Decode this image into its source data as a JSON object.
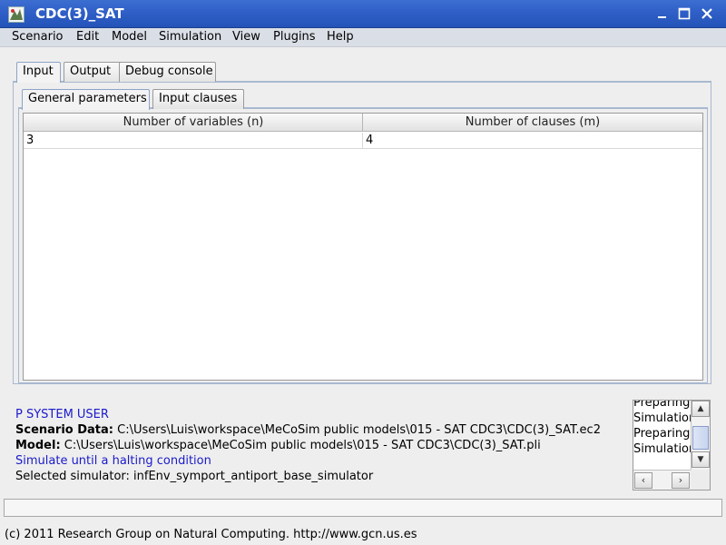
{
  "window": {
    "title": "CDC(3)_SAT"
  },
  "menu": [
    "Scenario",
    "Edit",
    "Model",
    "Simulation",
    "View",
    "Plugins",
    "Help"
  ],
  "outer_tabs": [
    "Input",
    "Output",
    "Debug console"
  ],
  "inner_tabs": [
    "General parameters",
    "Input clauses"
  ],
  "table": {
    "headers": [
      "Number of variables (n)",
      "Number of clauses (m)"
    ],
    "rows": [
      [
        "3",
        "4"
      ]
    ]
  },
  "info": {
    "user": "P SYSTEM USER",
    "scenario_label": "Scenario Data:",
    "scenario_value": "C:\\Users\\Luis\\workspace\\MeCoSim public models\\015 - SAT CDC3\\CDC(3)_SAT.ec2",
    "model_label": "Model:",
    "model_value": "C:\\Users\\Luis\\workspace\\MeCoSim public models\\015 - SAT CDC3\\CDC(3)_SAT.pli",
    "mode": "Simulate until a halting condition",
    "simulator": "Selected simulator: infEnv_symport_antiport_base_simulator"
  },
  "log": [
    "Preparing",
    "Simulation",
    "Preparing",
    "Simulation"
  ],
  "status_bar": "(c) 2011 Research Group on Natural Computing. http://www.gcn.us.es",
  "colors": {
    "titlebar": "#2f5fc7",
    "info_blue": "#1a1acc"
  }
}
